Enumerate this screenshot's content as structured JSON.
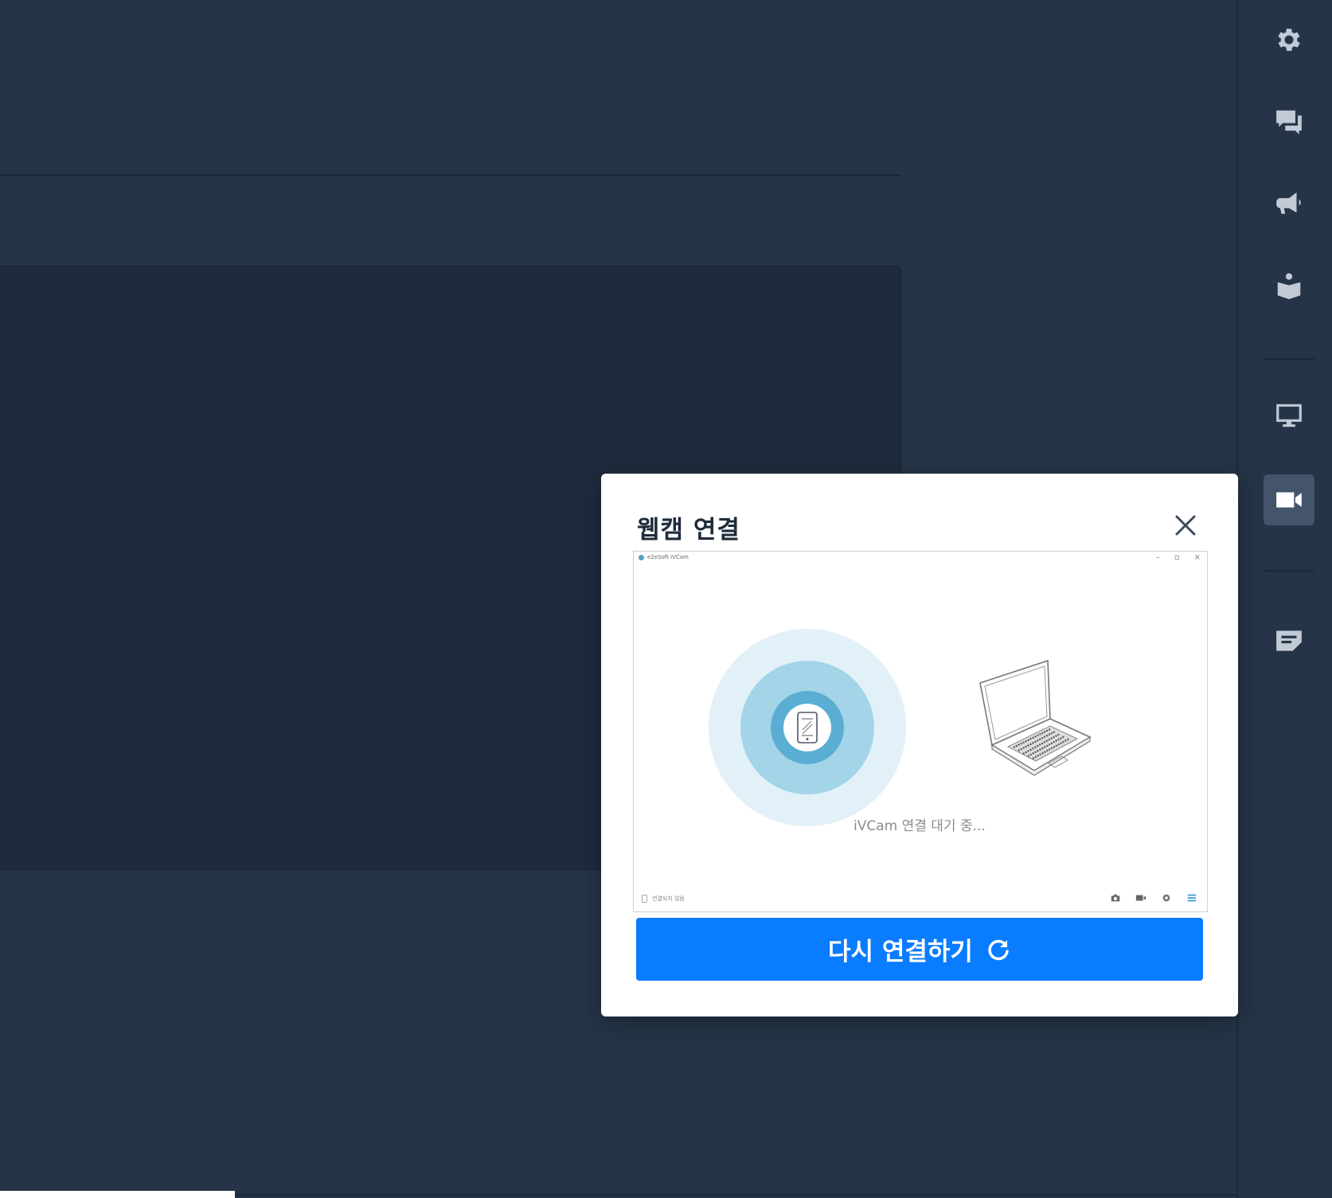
{
  "modal": {
    "title": "웹캠 연결",
    "preview": {
      "window_title": "e2eSoft iVCam",
      "status_text": "iVCam 연결 대기 중...",
      "footer_status": "연결되지 않음"
    },
    "reconnect_label": "다시 연결하기"
  },
  "sidebar": {
    "items": [
      {
        "icon": "gear-icon",
        "active": false
      },
      {
        "icon": "chat-icon",
        "active": false
      },
      {
        "icon": "megaphone-icon",
        "active": false
      },
      {
        "icon": "reader-icon",
        "active": false
      },
      {
        "icon": "monitor-icon",
        "active": false
      },
      {
        "icon": "video-camera-icon",
        "active": true
      },
      {
        "icon": "note-edit-icon",
        "active": false
      }
    ]
  },
  "colors": {
    "background": "#253547",
    "panel": "#1f2b3d",
    "accent": "#0a7cff",
    "sidebar_active": "#44556b"
  }
}
